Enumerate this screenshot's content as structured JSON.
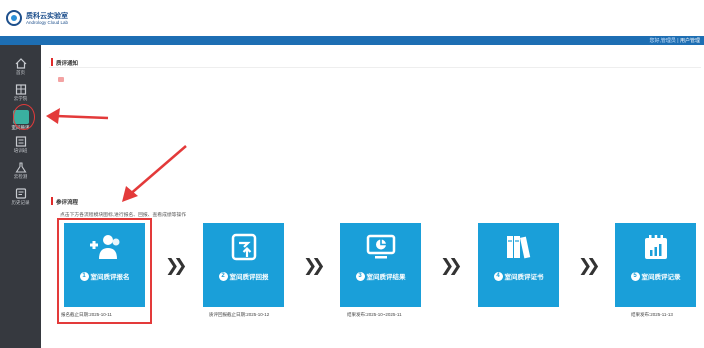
{
  "brand": {
    "title": "质科云实验室",
    "subtitle": "Andrology Cloud Lab"
  },
  "topbar": {
    "greeting": "您好,",
    "user": "管理员",
    "separator": " | ",
    "link": "用户管理"
  },
  "sidebar": {
    "items": [
      {
        "label": "首页",
        "icon": "home-icon"
      },
      {
        "label": "云学院",
        "icon": "book-icon"
      },
      {
        "label": "室间质评",
        "icon": "quality-icon",
        "active": true
      },
      {
        "label": "培训班",
        "icon": "training-icon"
      },
      {
        "label": "云检测",
        "icon": "flask-icon"
      },
      {
        "label": "历史记录",
        "icon": "history-icon"
      }
    ]
  },
  "notice": {
    "title": "质评通知"
  },
  "process": {
    "title": "参评流程",
    "hint": "点击下方各流程模块图标,进行报名、回报、查看成绩等操作",
    "steps": [
      {
        "num": "1",
        "label": "室间质评报名",
        "date": "报名截止日期:2025-10-11",
        "icon": "add-user-icon"
      },
      {
        "num": "2",
        "label": "室间质评回报",
        "date": "质评回报截止日期:2025-10-12",
        "icon": "upload-icon"
      },
      {
        "num": "3",
        "label": "室间质评结果",
        "date": "结果发布:2025-10~2025-11",
        "icon": "monitor-icon"
      },
      {
        "num": "4",
        "label": "室间质评证书",
        "date": "",
        "icon": "certificate-icon"
      },
      {
        "num": "5",
        "label": "室间质评记录",
        "date": "结果发布:2025-11-13",
        "icon": "calendar-chart-icon"
      }
    ],
    "chevron": "❯❯"
  },
  "colors": {
    "accent": "#1a9fd9",
    "topbar": "#1d6eb3",
    "sidebar": "#36393f",
    "highlight": "#e33a3a"
  }
}
